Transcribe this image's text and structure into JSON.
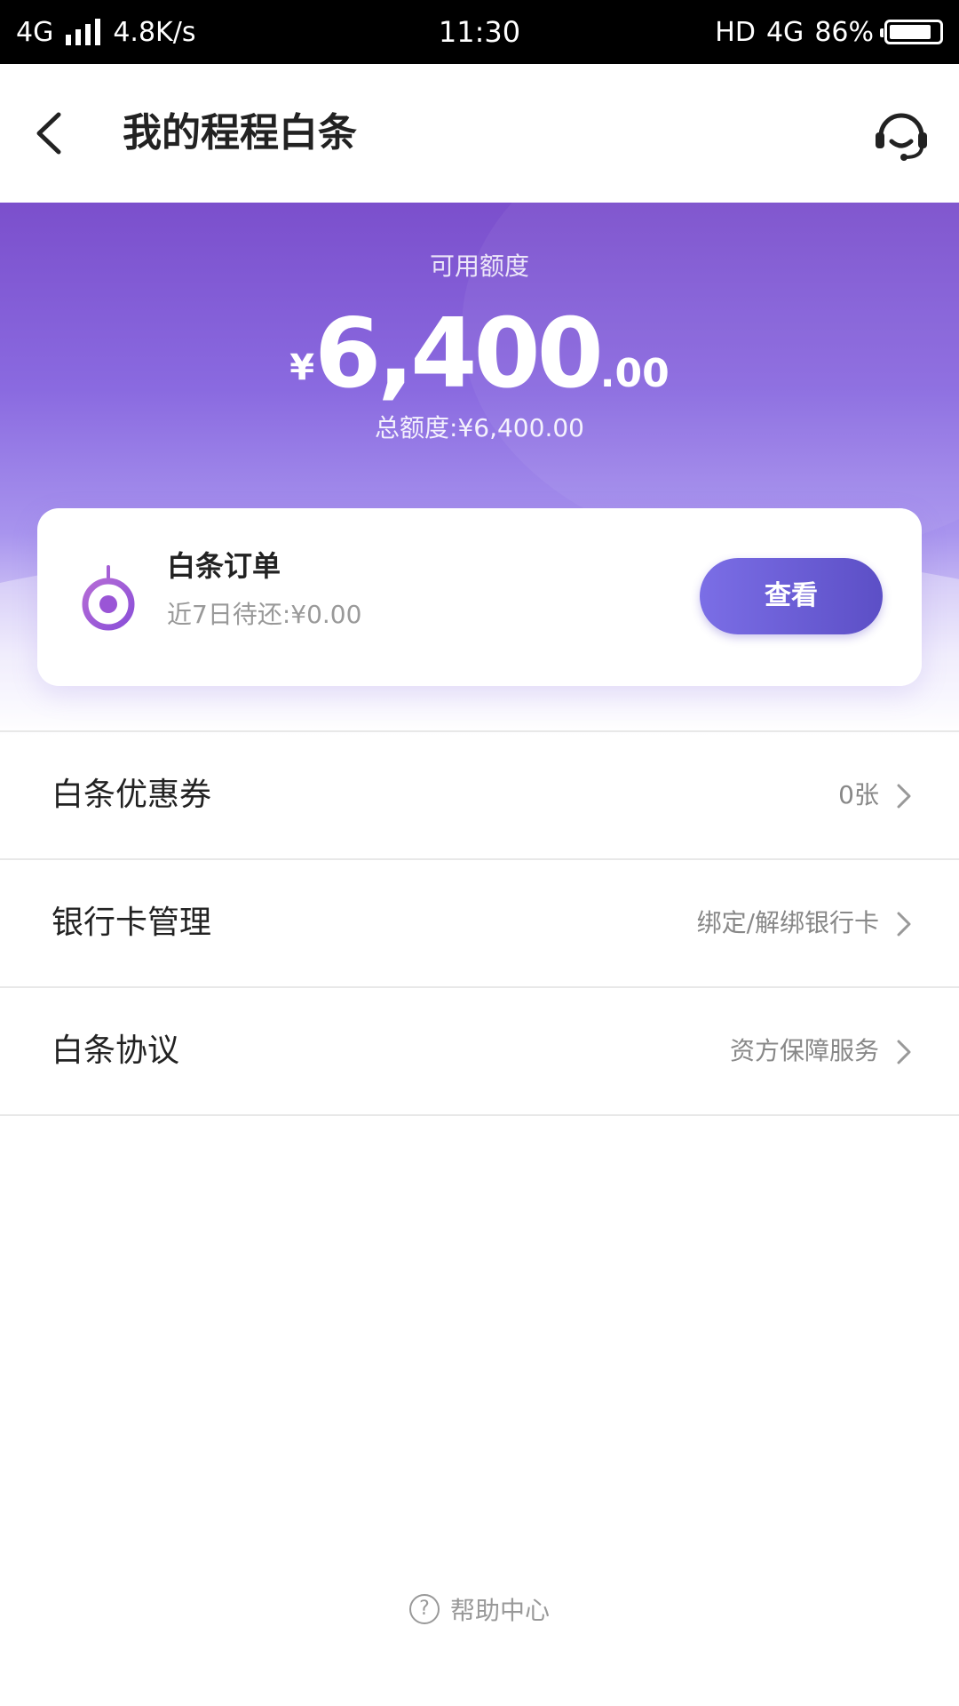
{
  "status_bar": {
    "network_left": "4G",
    "speed": "4.8K/s",
    "time": "11:30",
    "hd": "HD",
    "network_right": "4G",
    "battery_percent": "86%",
    "battery_level": 0.86
  },
  "header": {
    "title": "我的程程白条",
    "back_icon": "chevron-left-icon",
    "service_icon": "headset-icon"
  },
  "credit": {
    "label": "可用额度",
    "currency": "¥",
    "amount_int": "6,400",
    "amount_dec": ".00",
    "total": "总额度:¥6,400.00"
  },
  "order": {
    "title": "白条订单",
    "subtitle": "近7日待还:¥0.00",
    "button": "查看",
    "icon": "order-icon"
  },
  "menu": [
    {
      "label": "白条优惠券",
      "value": "0张"
    },
    {
      "label": "银行卡管理",
      "value": "绑定/解绑银行卡"
    },
    {
      "label": "白条协议",
      "value": "资方保障服务"
    }
  ],
  "help": {
    "label": "帮助中心",
    "icon_glyph": "?"
  },
  "colors": {
    "accent": "#6f5fdc",
    "hero_top": "#7b4fcc"
  }
}
